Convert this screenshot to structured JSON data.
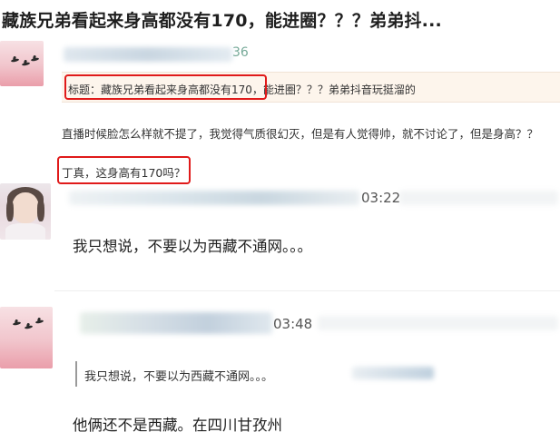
{
  "page": {
    "title": "藏族兄弟看起来身高都没有170，能进圈？？？弟弟抖..."
  },
  "post": {
    "user_suffix": "36",
    "quote_label": "标题：",
    "quote_title": "藏族兄弟看起来身高都没有170，能进圈？？？弟弟抖音玩挺溜的",
    "body": "直播时候脸怎么样就不提了，我觉得气质很幻灭，但是有人觉得帅，就不讨论了，但是身高？？",
    "question": "丁真，这身高有170吗？"
  },
  "reply1": {
    "time": "03:22",
    "text": "我只想说，不要以为西藏不通网。。。"
  },
  "reply2": {
    "time": "03:48",
    "quoted": "我只想说，不要以为西藏不通网。。。",
    "text": "他俩还不是西藏。在四川甘孜州"
  }
}
